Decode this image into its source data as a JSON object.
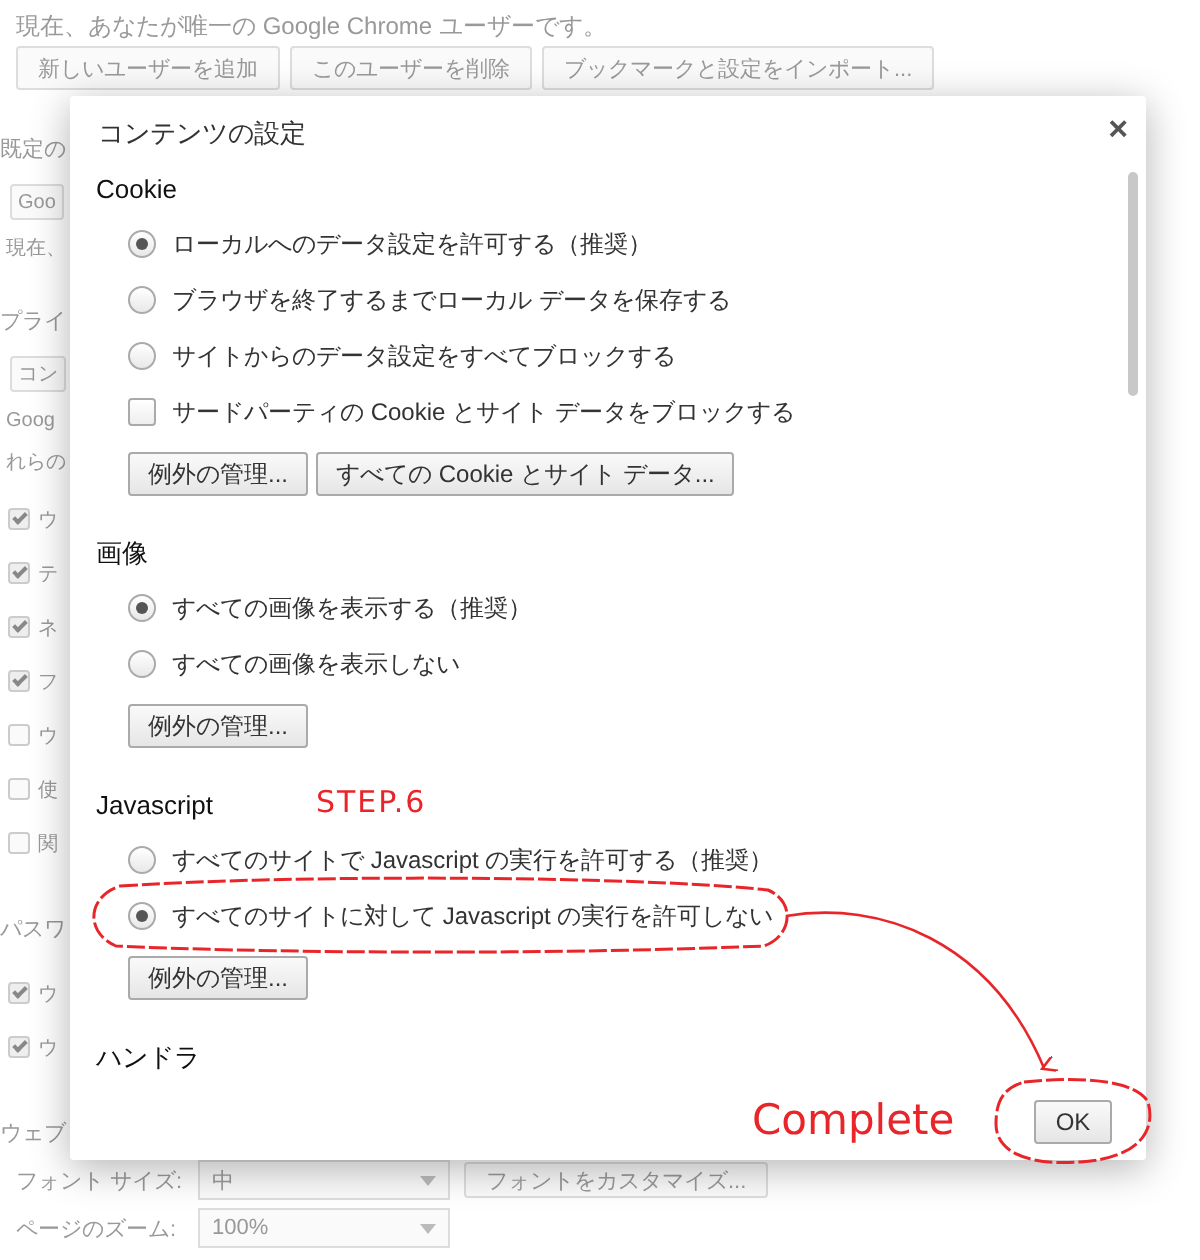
{
  "background_page": {
    "notice": "現在、あなたが唯一の Google Chrome ユーザーです。",
    "profile_buttons": [
      "新しいユーザーを追加",
      "このユーザーを削除",
      "ブックマークと設定をインポート..."
    ],
    "fragments": [
      {
        "kind": "heading",
        "text": "既定の"
      },
      {
        "kind": "button",
        "text": "Goo"
      },
      {
        "kind": "text",
        "text": "現在、"
      },
      {
        "kind": "heading",
        "text": "プライ"
      },
      {
        "kind": "button",
        "text": "コン"
      },
      {
        "kind": "text",
        "text": "Goog"
      },
      {
        "kind": "text",
        "text": "れらの"
      },
      {
        "kind": "checkbox",
        "text": "ウ",
        "checked": true
      },
      {
        "kind": "checkbox",
        "text": "テ",
        "checked": true
      },
      {
        "kind": "checkbox",
        "text": "ネ",
        "checked": true
      },
      {
        "kind": "checkbox",
        "text": "フ",
        "checked": true
      },
      {
        "kind": "checkbox",
        "text": "ウ",
        "checked": false
      },
      {
        "kind": "checkbox",
        "text": "使",
        "checked": false
      },
      {
        "kind": "checkbox",
        "text": "関",
        "checked": false
      },
      {
        "kind": "heading",
        "text": "パスワ"
      },
      {
        "kind": "checkbox",
        "text": "ウ",
        "checked": true
      },
      {
        "kind": "checkbox",
        "text": "ウ",
        "checked": true
      },
      {
        "kind": "heading",
        "text": "ウェブ"
      }
    ],
    "font_size": {
      "label": "フォント サイズ:",
      "value": "中"
    },
    "customize_button": "フォントをカスタマイズ...",
    "zoom": {
      "label": "ページのズーム:",
      "value": "100%"
    }
  },
  "dialog": {
    "title": "コンテンツの設定",
    "close": "×",
    "sections": [
      {
        "heading": "Cookie",
        "options": [
          {
            "kind": "radio",
            "label": "ローカルへのデータ設定を許可する（推奨）",
            "selected": true
          },
          {
            "kind": "radio",
            "label": "ブラウザを終了するまでローカル データを保存する",
            "selected": false
          },
          {
            "kind": "radio",
            "label": "サイトからのデータ設定をすべてブロックする",
            "selected": false
          },
          {
            "kind": "checkbox",
            "label": "サードパーティの Cookie とサイト データをブロックする",
            "checked": false
          }
        ],
        "buttons": [
          "例外の管理...",
          "すべての Cookie とサイト データ..."
        ]
      },
      {
        "heading": "画像",
        "options": [
          {
            "kind": "radio",
            "label": "すべての画像を表示する（推奨）",
            "selected": true
          },
          {
            "kind": "radio",
            "label": "すべての画像を表示しない",
            "selected": false
          }
        ],
        "buttons": [
          "例外の管理..."
        ]
      },
      {
        "heading": "Javascript",
        "options": [
          {
            "kind": "radio",
            "label": "すべてのサイトで Javascript の実行を許可する（推奨）",
            "selected": false
          },
          {
            "kind": "radio",
            "label": "すべてのサイトに対して Javascript の実行を許可しない",
            "selected": true
          }
        ],
        "buttons": [
          "例外の管理..."
        ]
      },
      {
        "heading": "ハンドラ"
      }
    ],
    "ok_button": "OK"
  },
  "annotations": [
    {
      "kind": "step",
      "text": "STEP.6"
    },
    {
      "kind": "caption",
      "text": "Complete"
    }
  ]
}
